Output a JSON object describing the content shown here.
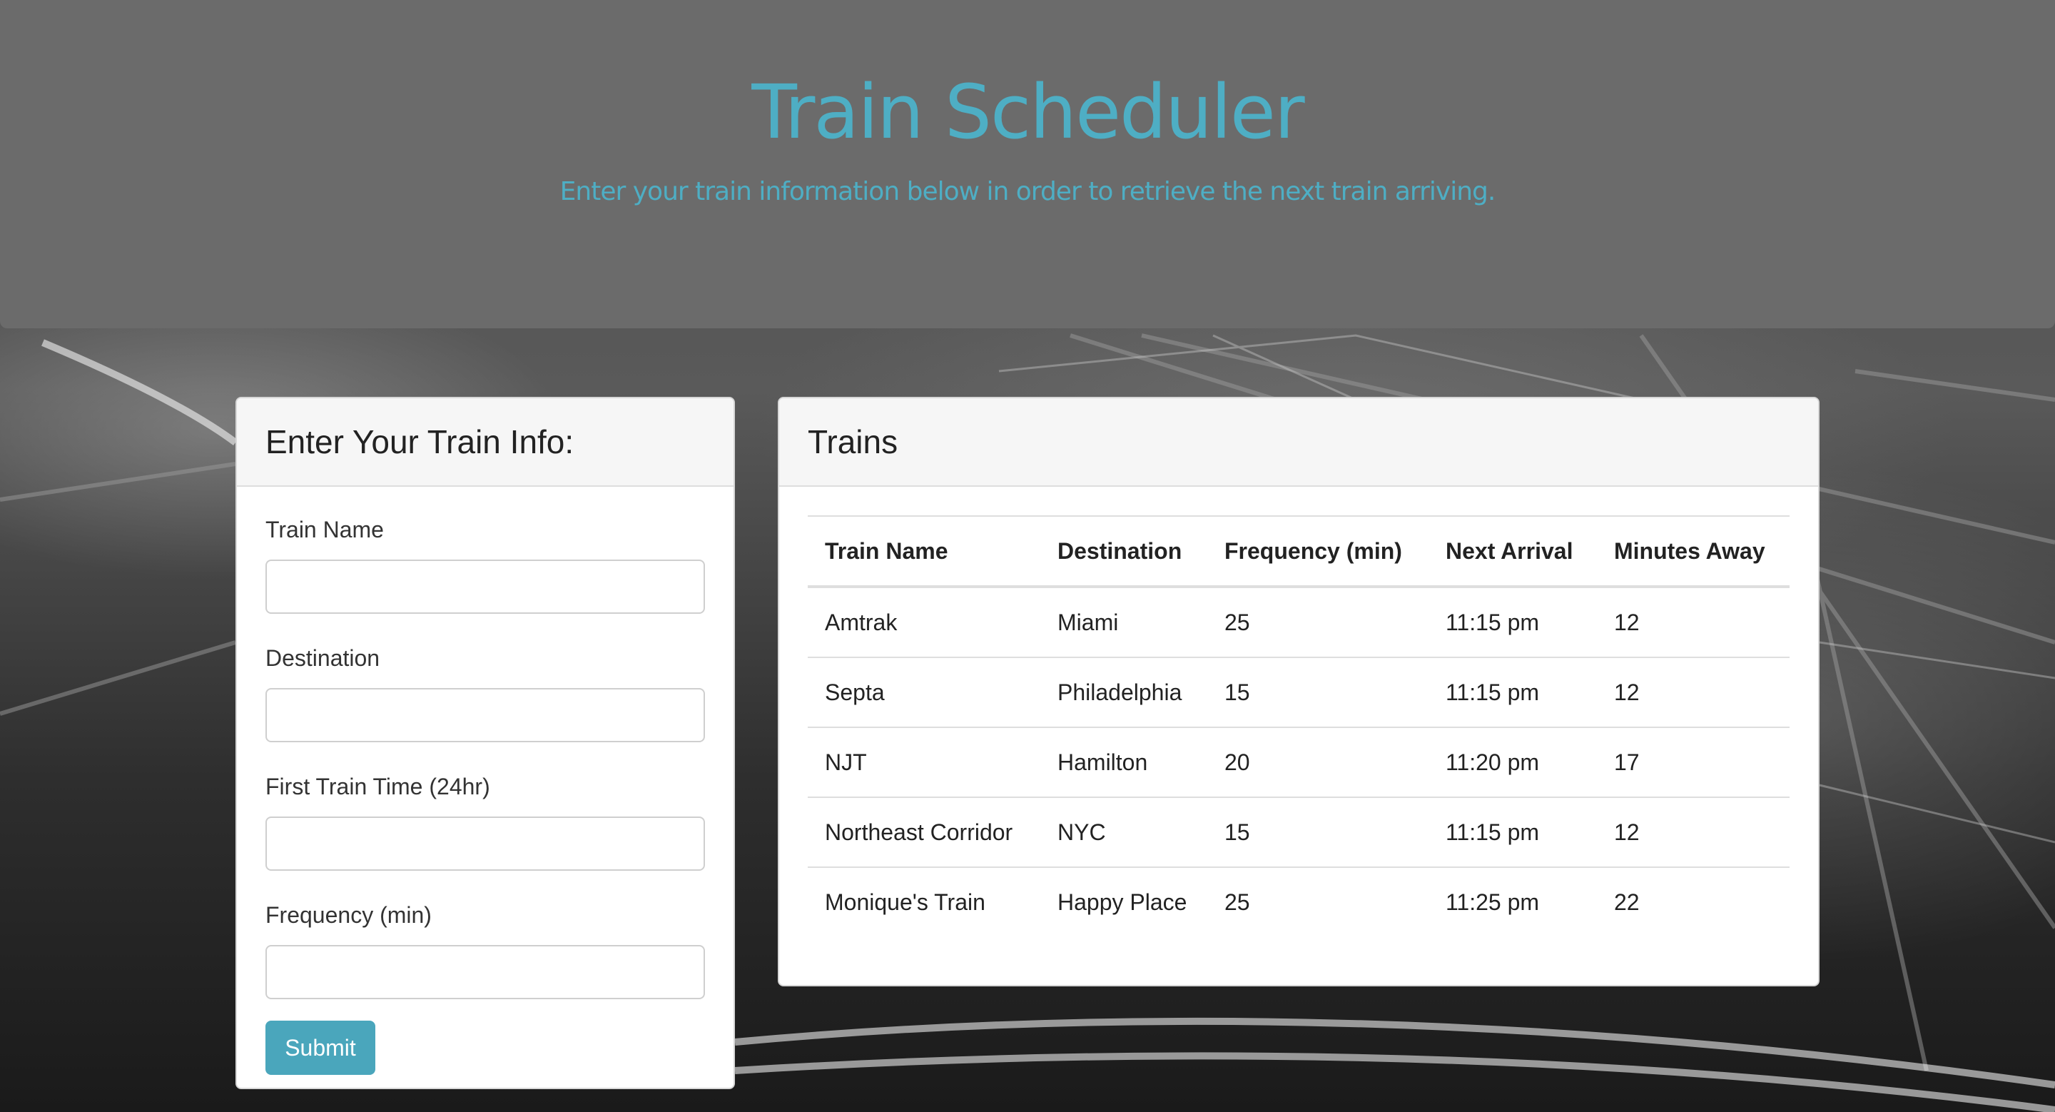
{
  "header": {
    "title": "Train Scheduler",
    "subtitle": "Enter your train information below in order to retrieve the next train arriving."
  },
  "form": {
    "heading": "Enter Your Train Info:",
    "fields": [
      {
        "label": "Train Name",
        "value": ""
      },
      {
        "label": "Destination",
        "value": ""
      },
      {
        "label": "First Train Time (24hr)",
        "value": ""
      },
      {
        "label": "Frequency (min)",
        "value": ""
      }
    ],
    "submit_label": "Submit"
  },
  "trains": {
    "heading": "Trains",
    "columns": [
      "Train Name",
      "Destination",
      "Frequency (min)",
      "Next Arrival",
      "Minutes Away"
    ],
    "rows": [
      [
        "Amtrak",
        "Miami",
        "25",
        "11:15 pm",
        "12"
      ],
      [
        "Septa",
        "Philadelphia",
        "15",
        "11:15 pm",
        "12"
      ],
      [
        "NJT",
        "Hamilton",
        "20",
        "11:20 pm",
        "17"
      ],
      [
        "Northeast Corridor",
        "NYC",
        "15",
        "11:15 pm",
        "12"
      ],
      [
        "Monique's Train",
        "Happy Place",
        "25",
        "11:25 pm",
        "22"
      ]
    ]
  },
  "colors": {
    "accent": "#4eaec4",
    "button": "#4aa6bc",
    "jumbotron": "#6b6b6b"
  }
}
